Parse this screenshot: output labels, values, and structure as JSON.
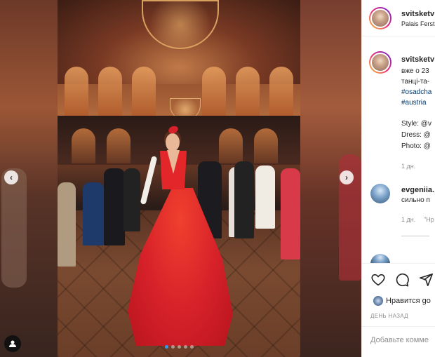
{
  "post": {
    "author": "svitsketv",
    "location": "Palais Ferst",
    "image_count": 5,
    "active_image": 1
  },
  "caption": {
    "author": "svitsketv",
    "lines": [
      "вже о 23",
      "танці-та-",
      "#osadcha",
      "#austria"
    ],
    "credits": [
      "Style: @v",
      "Dress: @",
      "Photo: @"
    ],
    "time": "1 дн."
  },
  "comments": [
    {
      "author": "evgeniia.",
      "text": "сильно п",
      "time": "1 дн.",
      "reply": "\"Нр"
    }
  ],
  "actions": {
    "icons": [
      "heart-icon",
      "comment-icon",
      "share-icon"
    ],
    "likes_text": "Нравится go",
    "date_label": "ДЕНЬ НАЗАД"
  },
  "comment_input": {
    "placeholder": "Добавьте комме"
  },
  "colors": {
    "link": "#00376b",
    "muted": "#8e8e8e",
    "dot_active": "#3897f0"
  }
}
